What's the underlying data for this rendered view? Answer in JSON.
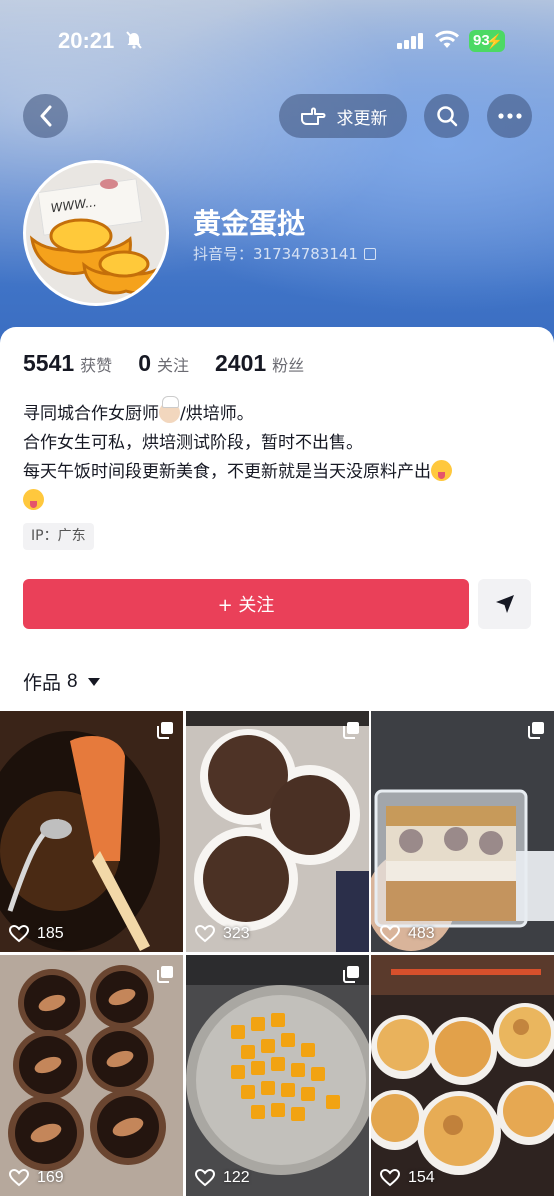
{
  "status_bar": {
    "time": "20:21",
    "battery": "93"
  },
  "nav": {
    "update_label": "求更新"
  },
  "profile": {
    "nickname": "黄金蛋挞",
    "douyin_id": "抖音号：31734783141",
    "avatar_note_text": "WWW..."
  },
  "stats": [
    {
      "value": "5541",
      "label": "获赞"
    },
    {
      "value": "0",
      "label": "关注"
    },
    {
      "value": "2401",
      "label": "粉丝"
    }
  ],
  "bio": {
    "line1_a": "寻同城合作女厨师",
    "line1_b": "/烘培师。",
    "line2": "合作女生可私，烘培测试阶段，暂时不出售。",
    "line3": "每天午饭时间段更新美食，不更新就是当天没原料产出"
  },
  "ip": "IP：广东",
  "actions": {
    "follow_label": "+ 关注"
  },
  "works": {
    "label": "作品",
    "count": "8"
  },
  "posts": [
    {
      "likes": "185",
      "desc": "chocolate-spatula"
    },
    {
      "likes": "323",
      "desc": "chocolate-buns"
    },
    {
      "likes": "483",
      "desc": "layered-cup-dessert"
    },
    {
      "likes": "169",
      "desc": "almond-chocolate-tarts"
    },
    {
      "likes": "122",
      "desc": "mango-cubes"
    },
    {
      "likes": "154",
      "desc": "baked-cheese-tarts"
    }
  ],
  "colors": {
    "accent": "#ea4059",
    "header_blue": "#4a7ac9"
  }
}
